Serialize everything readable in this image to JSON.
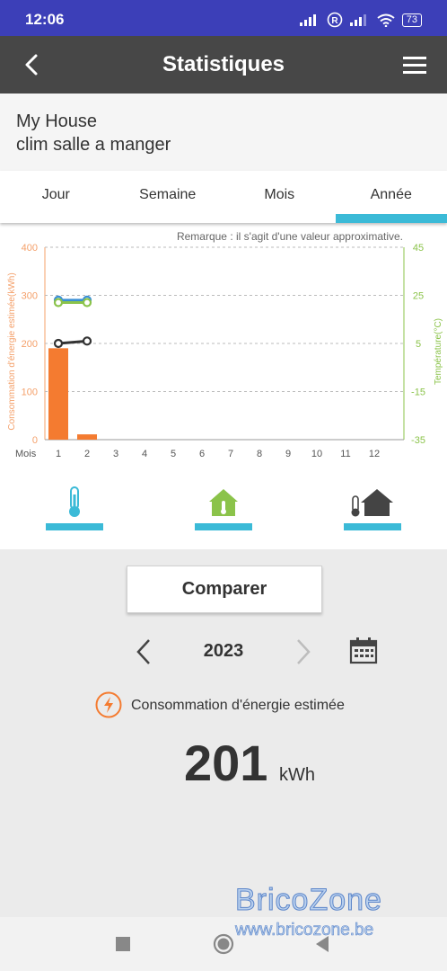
{
  "status_bar": {
    "time": "12:06",
    "battery": "73"
  },
  "header": {
    "title": "Statistiques"
  },
  "device": {
    "home": "My House",
    "name": "clim salle a manger"
  },
  "tabs": [
    {
      "label": "Jour",
      "active": false
    },
    {
      "label": "Semaine",
      "active": false
    },
    {
      "label": "Mois",
      "active": false
    },
    {
      "label": "Année",
      "active": true
    }
  ],
  "chart_data": {
    "type": "bar",
    "note": "Remarque : il s'agit d'une valeur approximative.",
    "xlabel": "Mois",
    "categories": [
      "1",
      "2",
      "3",
      "4",
      "5",
      "6",
      "7",
      "8",
      "9",
      "10",
      "11",
      "12"
    ],
    "ylabel_left": "Consommation d'énergie estimée(kWh)",
    "ylabel_right": "Température(°C)",
    "ylim_left": [
      0,
      400
    ],
    "ylim_right": [
      -35,
      45
    ],
    "left_ticks": [
      0,
      100,
      200,
      300,
      400
    ],
    "right_ticks": [
      -35,
      -15,
      5,
      25,
      45
    ],
    "grid": true,
    "series": [
      {
        "kind": "bar",
        "axis": "left",
        "color": "#f47b30",
        "values": [
          190,
          11,
          0,
          0,
          0,
          0,
          0,
          0,
          0,
          0,
          0,
          0
        ]
      },
      {
        "kind": "line",
        "axis": "right",
        "color": "#3a8fd6",
        "values": [
          23,
          23
        ]
      },
      {
        "kind": "line",
        "axis": "right",
        "color": "#8bc34a",
        "values": [
          22,
          22
        ]
      },
      {
        "kind": "line",
        "axis": "right",
        "color": "#333333",
        "values": [
          5,
          6
        ]
      }
    ]
  },
  "icon_selectors": [
    {
      "icon": "thermometer-icon"
    },
    {
      "icon": "house-temperature-icon"
    },
    {
      "icon": "outdoor-temperature-icon"
    }
  ],
  "compare_button": "Comparer",
  "year_nav": {
    "year": "2023"
  },
  "energy": {
    "label": "Consommation d'énergie estimée",
    "value": "201",
    "unit": "kWh"
  },
  "watermark": {
    "brand": "BricoZone",
    "url": "www.bricozone.be"
  },
  "colors": {
    "accent": "#3bbad7",
    "energy": "#f47b30",
    "temperature": "#8bc34a",
    "header": "#474747"
  }
}
